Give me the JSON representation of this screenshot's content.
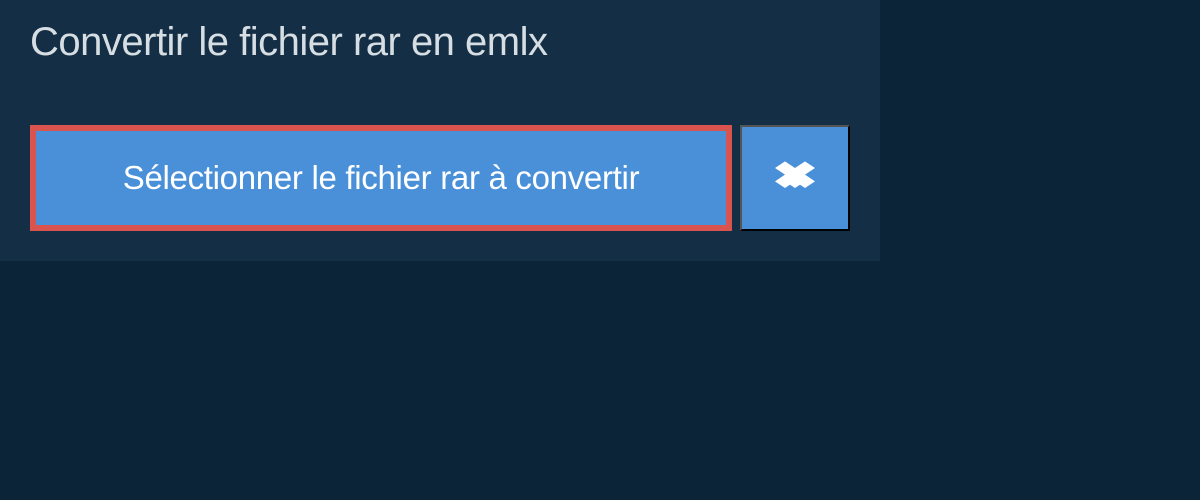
{
  "title": "Convertir le fichier rar en emlx",
  "buttons": {
    "select_file": "Sélectionner le fichier rar à convertir"
  },
  "colors": {
    "background": "#0c2438",
    "panel": "#142f45",
    "button": "#4a90d9",
    "highlight_border": "#d9534f"
  }
}
